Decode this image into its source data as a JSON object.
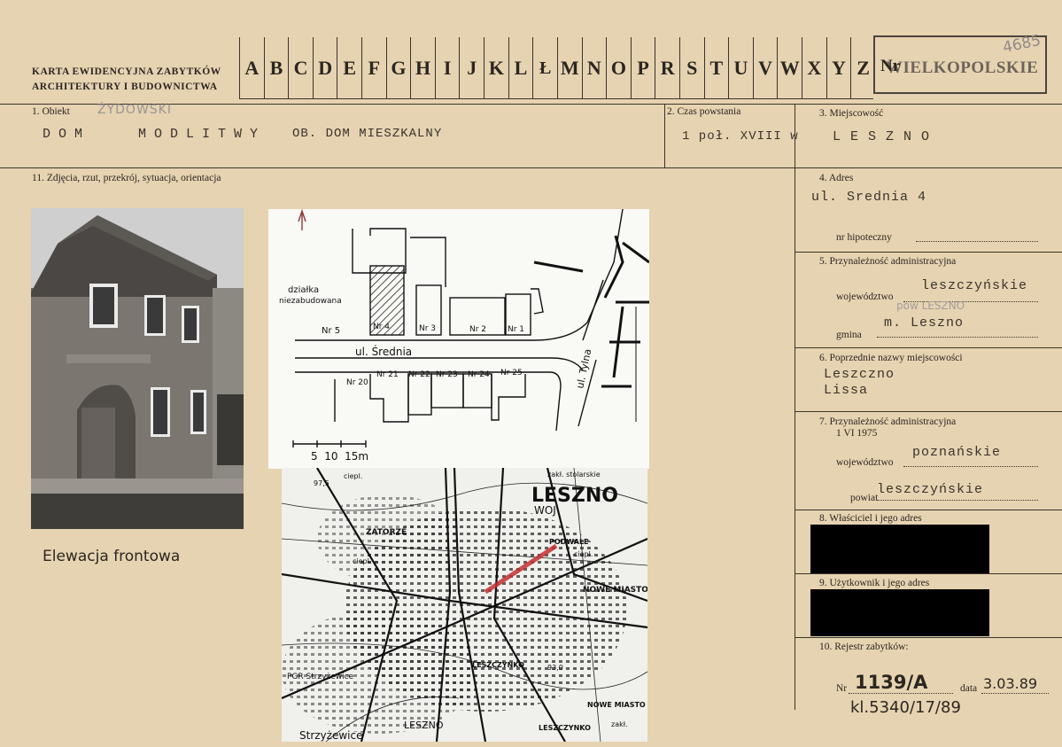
{
  "header": {
    "title_line1": "KARTA EWIDENCYJNA ZABYTKÓW",
    "title_line2": "ARCHITEKTURY I BUDOWNICTWA",
    "letters": [
      "A",
      "B",
      "C",
      "D",
      "E",
      "F",
      "G",
      "H",
      "I",
      "J",
      "K",
      "L",
      "Ł",
      "M",
      "N",
      "O",
      "P",
      "R",
      "S",
      "T",
      "U",
      "V",
      "W",
      "X",
      "Y",
      "Z"
    ],
    "nr_label": "Nr",
    "region_stamp": "WIELKOPOLSKIE",
    "card_number": "4685"
  },
  "field1": {
    "number": "1.",
    "label": "Obiekt",
    "handwritten_note": "ŻYDOWSKI",
    "value_a": "DOM   MODLITWY",
    "value_b": "OB. DOM MIESZKALNY"
  },
  "field2": {
    "number": "2.",
    "label": "Czas powstania",
    "value": "1 poł. XVIII w"
  },
  "field3": {
    "number": "3.",
    "label": "Miejscowość",
    "value": "L E S Z N O"
  },
  "field11": {
    "number": "11.",
    "label": "Zdjęcia, rzut, przekrój, sytuacja, orientacja",
    "photo_caption": "Elewacja frontowa"
  },
  "field4": {
    "number": "4.",
    "label": "Adres",
    "address": "ul. Srednia 4",
    "hipoteczny_label": "nr hipoteczny"
  },
  "field5": {
    "number": "5.",
    "label": "Przynależność administracyjna",
    "woj_label": "województwo",
    "woj_value": "leszczyńskie",
    "gmina_note": "pow LESZNO",
    "gmina_value": "m. Leszno",
    "gmina_label": "gmina"
  },
  "field6": {
    "number": "6.",
    "label": "Poprzednie nazwy miejscowości",
    "names": [
      "Leszczno",
      "Lissa"
    ]
  },
  "field7": {
    "number": "7.",
    "label": "Przynależność administracyjna",
    "date": "1 VI 1975",
    "woj_label": "województwo",
    "woj_value": "poznańskie",
    "powiat_label": "powiat",
    "powiat_value": "leszczyńskie"
  },
  "field8": {
    "number": "8.",
    "label": "Właściciel i jego adres"
  },
  "field9": {
    "number": "9.",
    "label": "Użytkownik i jego adres"
  },
  "field10": {
    "number": "10.",
    "label": "Rejestr zabytków:",
    "nr_label": "Nr",
    "nr_value": "1139/A",
    "data_label": "data",
    "data_value": "3.03.89",
    "kl_value": "kl.5340/17/89"
  },
  "plan": {
    "lot_label_1": "działka",
    "lot_label_2": "niezabudowana",
    "street": "ul. Średnia",
    "side_street": "ul. Tylna",
    "numbers_north": [
      "Nr 5",
      "Nr 4",
      "Nr 3",
      "Nr 2",
      "Nr 1"
    ],
    "numbers_south": [
      "Nr 20",
      "Nr 21",
      "Nr 22",
      "Nr 23",
      "Nr 24",
      "Nr 25"
    ],
    "scale": "5  10  15m"
  },
  "map": {
    "city": "LESZNO",
    "woj": "WOJ",
    "labels": [
      "zakł. stolarskie",
      "ciepl.",
      "97,5",
      "ZATORZE",
      "PODWALE",
      "ciepl.",
      "ciepl.",
      "NOWE MIASTO",
      "LESZCZYNKO",
      "PGR Strzyżewice",
      "93,0",
      "NOWE MIASTO",
      "Strzyżewice",
      "LESZNO",
      "LESZCZYNKO",
      "zakł."
    ]
  },
  "colors": {
    "card": "#e6d3b1",
    "ink": "#2b2620",
    "marker": "#c43030"
  }
}
